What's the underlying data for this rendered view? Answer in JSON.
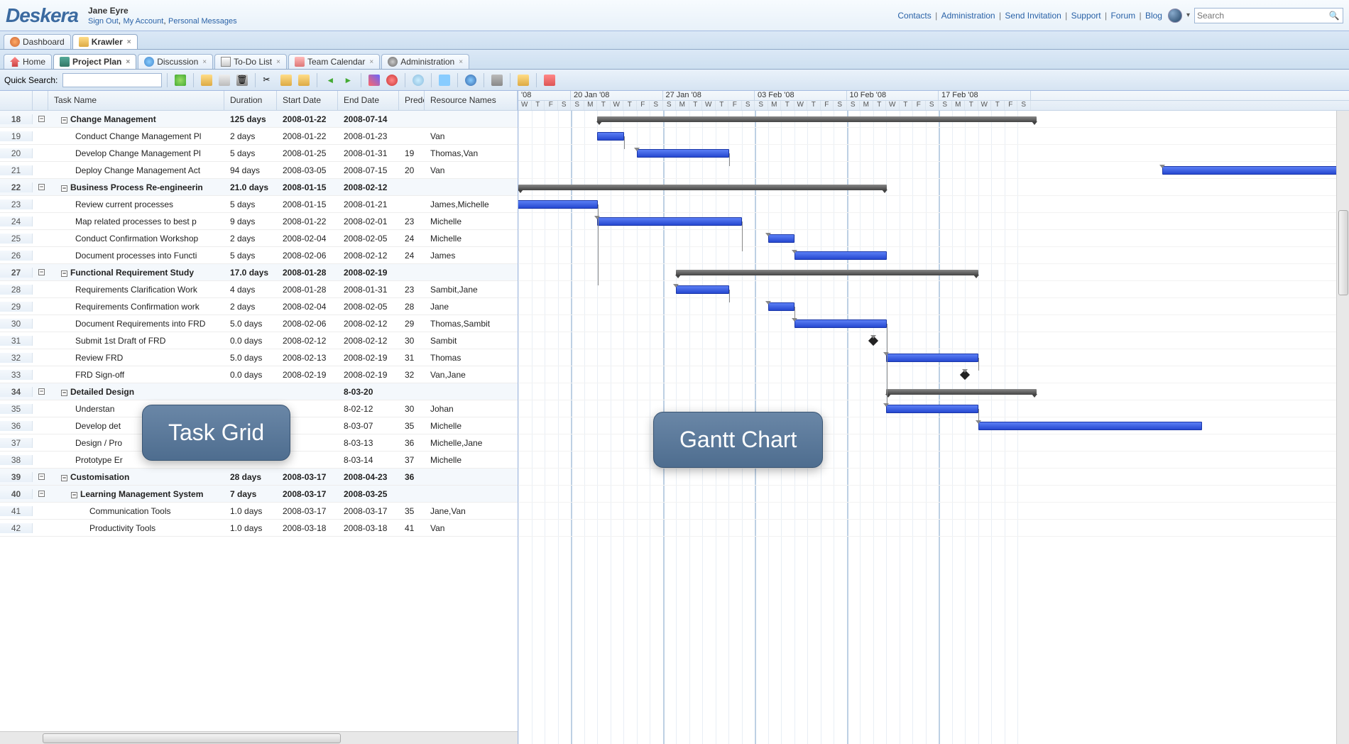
{
  "header": {
    "logo": "Deskera",
    "username": "Jane Eyre",
    "user_links": [
      "Sign Out",
      "My Account",
      "Personal Messages"
    ],
    "top_links": [
      "Contacts",
      "Administration",
      "Send Invitation",
      "Support",
      "Forum",
      "Blog"
    ],
    "search_placeholder": "Search"
  },
  "tabs_main": [
    {
      "label": "Dashboard",
      "active": false
    },
    {
      "label": "Krawler",
      "active": true,
      "closable": true
    }
  ],
  "tabs_secondary": [
    {
      "label": "Home"
    },
    {
      "label": "Project Plan",
      "active": true,
      "closable": true
    },
    {
      "label": "Discussion",
      "closable": true
    },
    {
      "label": "To-Do List",
      "closable": true
    },
    {
      "label": "Team Calendar",
      "closable": true
    },
    {
      "label": "Administration",
      "closable": true
    }
  ],
  "toolbar": {
    "quick_search_label": "Quick Search:"
  },
  "grid": {
    "columns": [
      "",
      "Task Name",
      "Duration",
      "Start Date",
      "End Date",
      "Prede",
      "Resource Names"
    ],
    "rows": [
      {
        "num": 18,
        "level": 1,
        "summary": true,
        "task": "Change Management",
        "dur": "125 days",
        "sd": "2008-01-22",
        "ed": "2008-07-14"
      },
      {
        "num": 19,
        "level": 2,
        "task": "Conduct Change Management Pl",
        "dur": "2 days",
        "sd": "2008-01-22",
        "ed": "2008-01-23",
        "res": "Van"
      },
      {
        "num": 20,
        "level": 2,
        "task": "Develop Change Management Pl",
        "dur": "5 days",
        "sd": "2008-01-25",
        "ed": "2008-01-31",
        "pred": "19",
        "res": "Thomas,Van"
      },
      {
        "num": 21,
        "level": 2,
        "task": "Deploy Change Management Act",
        "dur": "94 days",
        "sd": "2008-03-05",
        "ed": "2008-07-15",
        "pred": "20",
        "res": "Van"
      },
      {
        "num": 22,
        "level": 1,
        "summary": true,
        "task": "Business Process Re-engineerin",
        "dur": "21.0 days",
        "sd": "2008-01-15",
        "ed": "2008-02-12"
      },
      {
        "num": 23,
        "level": 2,
        "task": "Review current processes",
        "dur": "5 days",
        "sd": "2008-01-15",
        "ed": "2008-01-21",
        "res": "James,Michelle"
      },
      {
        "num": 24,
        "level": 2,
        "task": "Map related processes to best p",
        "dur": "9 days",
        "sd": "2008-01-22",
        "ed": "2008-02-01",
        "pred": "23",
        "res": "Michelle"
      },
      {
        "num": 25,
        "level": 2,
        "task": "Conduct Confirmation Workshop",
        "dur": "2 days",
        "sd": "2008-02-04",
        "ed": "2008-02-05",
        "pred": "24",
        "res": "Michelle"
      },
      {
        "num": 26,
        "level": 2,
        "task": "Document processes into Functi",
        "dur": "5 days",
        "sd": "2008-02-06",
        "ed": "2008-02-12",
        "pred": "24",
        "res": "James"
      },
      {
        "num": 27,
        "level": 1,
        "summary": true,
        "task": "Functional Requirement Study",
        "dur": "17.0 days",
        "sd": "2008-01-28",
        "ed": "2008-02-19"
      },
      {
        "num": 28,
        "level": 2,
        "task": "Requirements Clarification Work",
        "dur": "4 days",
        "sd": "2008-01-28",
        "ed": "2008-01-31",
        "pred": "23",
        "res": "Sambit,Jane"
      },
      {
        "num": 29,
        "level": 2,
        "task": "Requirements Confirmation work",
        "dur": "2 days",
        "sd": "2008-02-04",
        "ed": "2008-02-05",
        "pred": "28",
        "res": "Jane"
      },
      {
        "num": 30,
        "level": 2,
        "task": "Document Requirements into FRD",
        "dur": "5.0 days",
        "sd": "2008-02-06",
        "ed": "2008-02-12",
        "pred": "29",
        "res": "Thomas,Sambit"
      },
      {
        "num": 31,
        "level": 2,
        "task": "Submit 1st Draft of FRD",
        "dur": "0.0 days",
        "sd": "2008-02-12",
        "ed": "2008-02-12",
        "pred": "30",
        "res": "Sambit"
      },
      {
        "num": 32,
        "level": 2,
        "task": "Review FRD",
        "dur": "5.0 days",
        "sd": "2008-02-13",
        "ed": "2008-02-19",
        "pred": "31",
        "res": "Thomas"
      },
      {
        "num": 33,
        "level": 2,
        "task": "FRD Sign-off",
        "dur": "0.0 days",
        "sd": "2008-02-19",
        "ed": "2008-02-19",
        "pred": "32",
        "res": "Van,Jane"
      },
      {
        "num": 34,
        "level": 1,
        "summary": true,
        "task": "Detailed Design",
        "ed": "8-03-20"
      },
      {
        "num": 35,
        "level": 2,
        "task": "Understan",
        "ed": "8-02-12",
        "pred": "30",
        "res": "Johan"
      },
      {
        "num": 36,
        "level": 2,
        "task": "Develop det",
        "ed": "8-03-07",
        "pred": "35",
        "res": "Michelle"
      },
      {
        "num": 37,
        "level": 2,
        "task": "Design / Pro",
        "ed": "8-03-13",
        "pred": "36",
        "res": "Michelle,Jane"
      },
      {
        "num": 38,
        "level": 2,
        "task": "Prototype Er",
        "ed": "8-03-14",
        "pred": "37",
        "res": "Michelle"
      },
      {
        "num": 39,
        "level": 1,
        "summary": true,
        "task": "Customisation",
        "dur": "28 days",
        "sd": "2008-03-17",
        "ed": "2008-04-23",
        "pred": "36"
      },
      {
        "num": 40,
        "level": 2,
        "summary": true,
        "task": "Learning Management System",
        "dur": "7 days",
        "sd": "2008-03-17",
        "ed": "2008-03-25"
      },
      {
        "num": 41,
        "level": 3,
        "task": "Communication Tools",
        "dur": "1.0 days",
        "sd": "2008-03-17",
        "ed": "2008-03-17",
        "pred": "35",
        "res": "Jane,Van"
      },
      {
        "num": 42,
        "level": 3,
        "task": "Productivity Tools",
        "dur": "1.0 days",
        "sd": "2008-03-18",
        "ed": "2008-03-18",
        "pred": "41",
        "res": "Van"
      }
    ]
  },
  "gantt": {
    "weeks": [
      "'08",
      "20 Jan '08",
      "27 Jan '08",
      "03 Feb '08",
      "10 Feb '08",
      "17 Feb '08"
    ],
    "day_letters": [
      "W",
      "T",
      "F",
      "S",
      "S",
      "M",
      "T",
      "W",
      "T",
      "F",
      "S",
      "S",
      "M",
      "T",
      "W",
      "T",
      "F",
      "S",
      "S",
      "M",
      "T",
      "W",
      "T",
      "F",
      "S",
      "S",
      "M",
      "T",
      "W",
      "T",
      "F",
      "S",
      "S",
      "M",
      "T",
      "W",
      "T",
      "F",
      "S"
    ]
  },
  "callouts": {
    "left": "Task Grid",
    "right": "Gantt Chart"
  },
  "chart_data": {
    "type": "gantt",
    "title": "Project Plan – Gantt",
    "date_origin": "2008-01-16",
    "pixels_per_day": 18.5,
    "visible_range": [
      "2008-01-16",
      "2008-02-23"
    ],
    "items": [
      {
        "id": 18,
        "name": "Change Management",
        "kind": "summary",
        "start": "2008-01-22",
        "end": "2008-07-14"
      },
      {
        "id": 19,
        "name": "Conduct Change Management Planning",
        "kind": "task",
        "start": "2008-01-22",
        "end": "2008-01-23",
        "pred": []
      },
      {
        "id": 20,
        "name": "Develop Change Management Plan",
        "kind": "task",
        "start": "2008-01-25",
        "end": "2008-01-31",
        "pred": [
          19
        ]
      },
      {
        "id": 21,
        "name": "Deploy Change Management Actions",
        "kind": "task",
        "start": "2008-03-05",
        "end": "2008-07-15",
        "pred": [
          20
        ]
      },
      {
        "id": 22,
        "name": "Business Process Re-engineering",
        "kind": "summary",
        "start": "2008-01-15",
        "end": "2008-02-12"
      },
      {
        "id": 23,
        "name": "Review current processes",
        "kind": "task",
        "start": "2008-01-15",
        "end": "2008-01-21",
        "pred": []
      },
      {
        "id": 24,
        "name": "Map related processes to best practice",
        "kind": "task",
        "start": "2008-01-22",
        "end": "2008-02-01",
        "pred": [
          23
        ]
      },
      {
        "id": 25,
        "name": "Conduct Confirmation Workshops",
        "kind": "task",
        "start": "2008-02-04",
        "end": "2008-02-05",
        "pred": [
          24
        ]
      },
      {
        "id": 26,
        "name": "Document processes into Functions",
        "kind": "task",
        "start": "2008-02-06",
        "end": "2008-02-12",
        "pred": [
          24
        ]
      },
      {
        "id": 27,
        "name": "Functional Requirement Study",
        "kind": "summary",
        "start": "2008-01-28",
        "end": "2008-02-19"
      },
      {
        "id": 28,
        "name": "Requirements Clarification Workshop",
        "kind": "task",
        "start": "2008-01-28",
        "end": "2008-01-31",
        "pred": [
          23
        ]
      },
      {
        "id": 29,
        "name": "Requirements Confirmation workshop",
        "kind": "task",
        "start": "2008-02-04",
        "end": "2008-02-05",
        "pred": [
          28
        ]
      },
      {
        "id": 30,
        "name": "Document Requirements into FRD",
        "kind": "task",
        "start": "2008-02-06",
        "end": "2008-02-12",
        "pred": [
          29
        ]
      },
      {
        "id": 31,
        "name": "Submit 1st Draft of FRD",
        "kind": "milestone",
        "start": "2008-02-12",
        "end": "2008-02-12",
        "pred": [
          30
        ]
      },
      {
        "id": 32,
        "name": "Review FRD",
        "kind": "task",
        "start": "2008-02-13",
        "end": "2008-02-19",
        "pred": [
          31
        ]
      },
      {
        "id": 33,
        "name": "FRD Sign-off",
        "kind": "milestone",
        "start": "2008-02-19",
        "end": "2008-02-19",
        "pred": [
          32
        ]
      },
      {
        "id": 34,
        "name": "Detailed Design",
        "kind": "summary",
        "start": "2008-02-13",
        "end": "2008-03-20"
      },
      {
        "id": 35,
        "name": "Understand Requirements",
        "kind": "task",
        "start": "2008-02-13",
        "end": "2008-02-19",
        "pred": [
          30
        ]
      },
      {
        "id": 36,
        "name": "Develop detailed design",
        "kind": "task",
        "start": "2008-02-20",
        "end": "2008-03-07",
        "pred": [
          35
        ]
      }
    ]
  }
}
